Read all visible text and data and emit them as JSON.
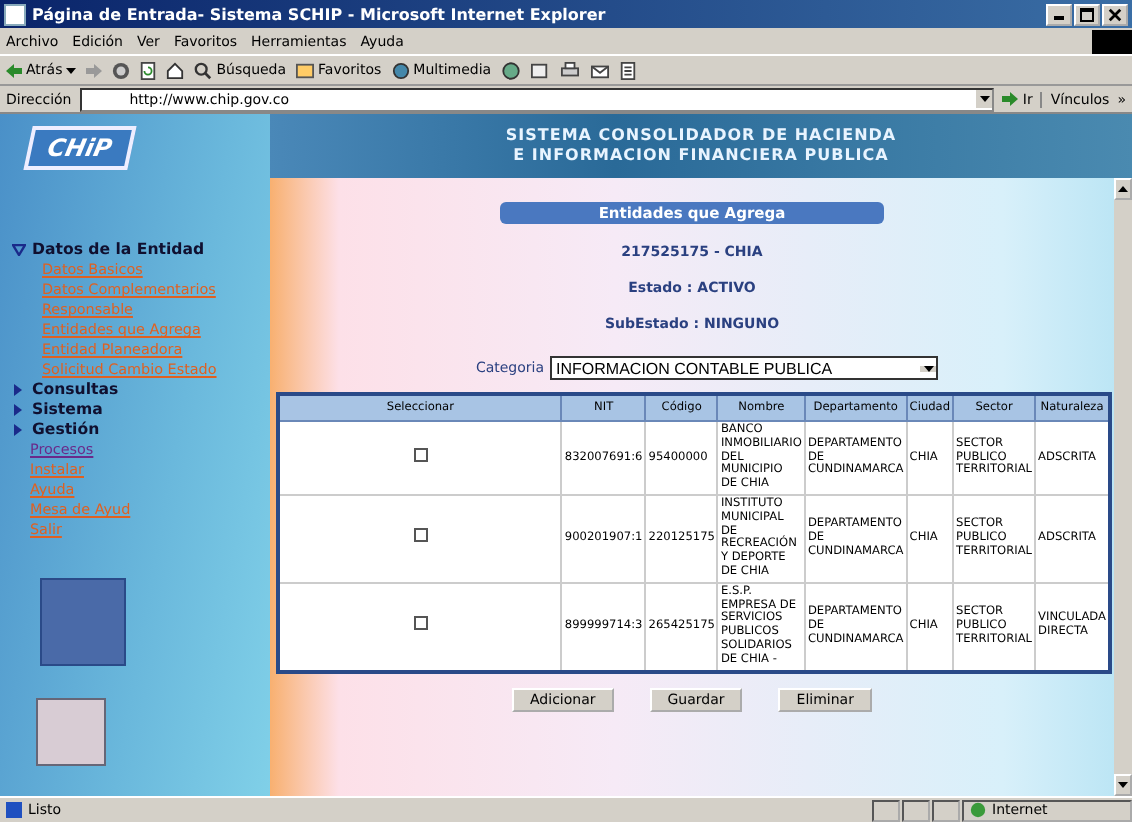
{
  "window": {
    "title": "Página de Entrada- Sistema SCHIP - Microsoft Internet Explorer"
  },
  "menu_bar": [
    "Archivo",
    "Edición",
    "Ver",
    "Favoritos",
    "Herramientas",
    "Ayuda"
  ],
  "toolbar": {
    "back": "Atrás",
    "search": "Búsqueda",
    "favorites": "Favoritos",
    "media": "Multimedia"
  },
  "address_bar": {
    "label": "Dirección",
    "url": "http://www.chip.gov.co",
    "go": "Ir",
    "links": "Vínculos",
    "more": "»"
  },
  "sidebar": {
    "logo": "CHiP",
    "sections": [
      {
        "label": "Datos de la Entidad",
        "expanded": true,
        "children": [
          "Datos Basicos",
          "Datos Complementarios",
          "Responsable",
          "Entidades que Agrega",
          "Entidad Planeadora",
          "Solicitud Cambio Estado"
        ]
      },
      {
        "label": "Consultas",
        "expanded": false
      },
      {
        "label": "Sistema",
        "expanded": false
      },
      {
        "label": "Gestión",
        "expanded": false
      }
    ],
    "links": [
      {
        "label": "Procesos",
        "visited": true
      },
      {
        "label": "Instalar",
        "visited": false
      },
      {
        "label": "Ayuda",
        "visited": false
      },
      {
        "label": "Mesa de Ayud",
        "visited": false
      },
      {
        "label": "Salir",
        "visited": false
      }
    ]
  },
  "banner": [
    "SISTEMA CONSOLIDADOR DE HACIENDA",
    "E INFORMACION FINANCIERA PUBLICA"
  ],
  "page": {
    "heading": "Entidades que Agrega",
    "entity": "217525175 - CHIA",
    "estado": "Estado : ACTIVO",
    "subestado": "SubEstado : NINGUNO",
    "category_label": "Categoria",
    "category_value": "INFORMACION CONTABLE PUBLICA"
  },
  "table": {
    "columns": [
      "Seleccionar",
      "NIT",
      "Código",
      "Nombre",
      "Departamento",
      "Ciudad",
      "Sector",
      "Naturaleza"
    ],
    "rows": [
      {
        "seleccionar": {
          "checked": false
        },
        "nit": "832007691:6",
        "codigo": "95400000",
        "nombre": "BANCO INMOBILIARIO DEL MUNICIPIO DE CHIA",
        "departamento": "DEPARTAMENTO DE CUNDINAMARCA",
        "ciudad": "CHIA",
        "sector": "SECTOR PUBLICO TERRITORIAL",
        "naturaleza": "ADSCRITA"
      },
      {
        "seleccionar": {
          "checked": false
        },
        "nit": "900201907:1",
        "codigo": "220125175",
        "nombre": "INSTITUTO MUNICIPAL DE RECREACIÓN Y DEPORTE DE CHIA",
        "departamento": "DEPARTAMENTO DE CUNDINAMARCA",
        "ciudad": "CHIA",
        "sector": "SECTOR PUBLICO TERRITORIAL",
        "naturaleza": "ADSCRITA"
      },
      {
        "seleccionar": {
          "checked": false
        },
        "nit": "899999714:3",
        "codigo": "265425175",
        "nombre": "E.S.P. EMPRESA DE SERVICIOS PUBLICOS SOLIDARIOS DE CHIA -",
        "departamento": "DEPARTAMENTO DE CUNDINAMARCA",
        "ciudad": "CHIA",
        "sector": "SECTOR PUBLICO TERRITORIAL",
        "naturaleza": "VINCULADA DIRECTA"
      }
    ]
  },
  "buttons": [
    "Adicionar",
    "Guardar",
    "Eliminar"
  ],
  "status_bar": {
    "text": "Listo",
    "zone": "Internet"
  }
}
